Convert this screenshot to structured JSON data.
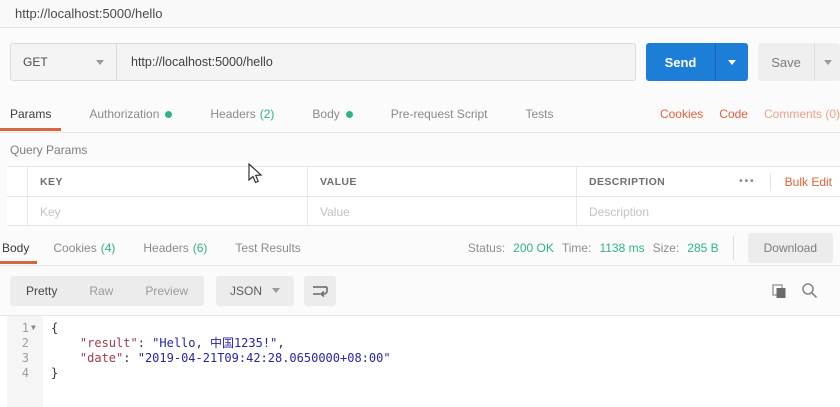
{
  "tab_bar": {
    "title": "http://localhost:5000/hello"
  },
  "request": {
    "method": "GET",
    "url": "http://localhost:5000/hello",
    "send_label": "Send",
    "save_label": "Save",
    "tabs": [
      {
        "label": "Params",
        "active": true
      },
      {
        "label": "Authorization",
        "dot": true
      },
      {
        "label": "Headers",
        "count": "(2)"
      },
      {
        "label": "Body",
        "dot": true
      },
      {
        "label": "Pre-request Script"
      },
      {
        "label": "Tests"
      }
    ],
    "links": {
      "cookies": "Cookies",
      "code": "Code",
      "comments": "Comments (0)"
    }
  },
  "query_params": {
    "title": "Query Params",
    "headers": {
      "key": "KEY",
      "value": "VALUE",
      "description": "DESCRIPTION"
    },
    "more": "•••",
    "bulk_edit": "Bulk Edit",
    "placeholders": {
      "key": "Key",
      "value": "Value",
      "description": "Description"
    }
  },
  "response": {
    "tabs": [
      {
        "label": "Body",
        "active": true
      },
      {
        "label": "Cookies",
        "count": "(4)"
      },
      {
        "label": "Headers",
        "count": "(6)"
      },
      {
        "label": "Test Results"
      }
    ],
    "meta": {
      "status_label": "Status:",
      "status_value": "200 OK",
      "time_label": "Time:",
      "time_value": "1138 ms",
      "size_label": "Size:",
      "size_value": "285 B",
      "download_label": "Download"
    },
    "toolbar": {
      "views": [
        "Pretty",
        "Raw",
        "Preview"
      ],
      "active_view": "Pretty",
      "format": "JSON"
    },
    "body_json": {
      "lines": [
        {
          "num": "1",
          "fold": true,
          "segments": [
            {
              "text": "{",
              "type": "plain"
            }
          ]
        },
        {
          "num": "2",
          "fold": false,
          "segments": [
            {
              "text": "    ",
              "type": "plain"
            },
            {
              "text": "\"result\"",
              "type": "key"
            },
            {
              "text": ": ",
              "type": "plain"
            },
            {
              "text": "\"Hello, 中国1235!\"",
              "type": "string"
            },
            {
              "text": ",",
              "type": "plain"
            }
          ]
        },
        {
          "num": "3",
          "fold": false,
          "segments": [
            {
              "text": "    ",
              "type": "plain"
            },
            {
              "text": "\"date\"",
              "type": "key"
            },
            {
              "text": ": ",
              "type": "plain"
            },
            {
              "text": "\"2019-04-21T09:42:28.0650000+08:00\"",
              "type": "string"
            }
          ]
        },
        {
          "num": "4",
          "fold": false,
          "segments": [
            {
              "text": "}",
              "type": "plain"
            }
          ]
        }
      ]
    }
  },
  "colors": {
    "accent_orange": "#e8603c",
    "underline_orange": "#d9663e",
    "green": "#2db57e",
    "send_blue": "#1c7ed6",
    "json_key": "#a63a4a",
    "json_string": "#2626a8"
  }
}
